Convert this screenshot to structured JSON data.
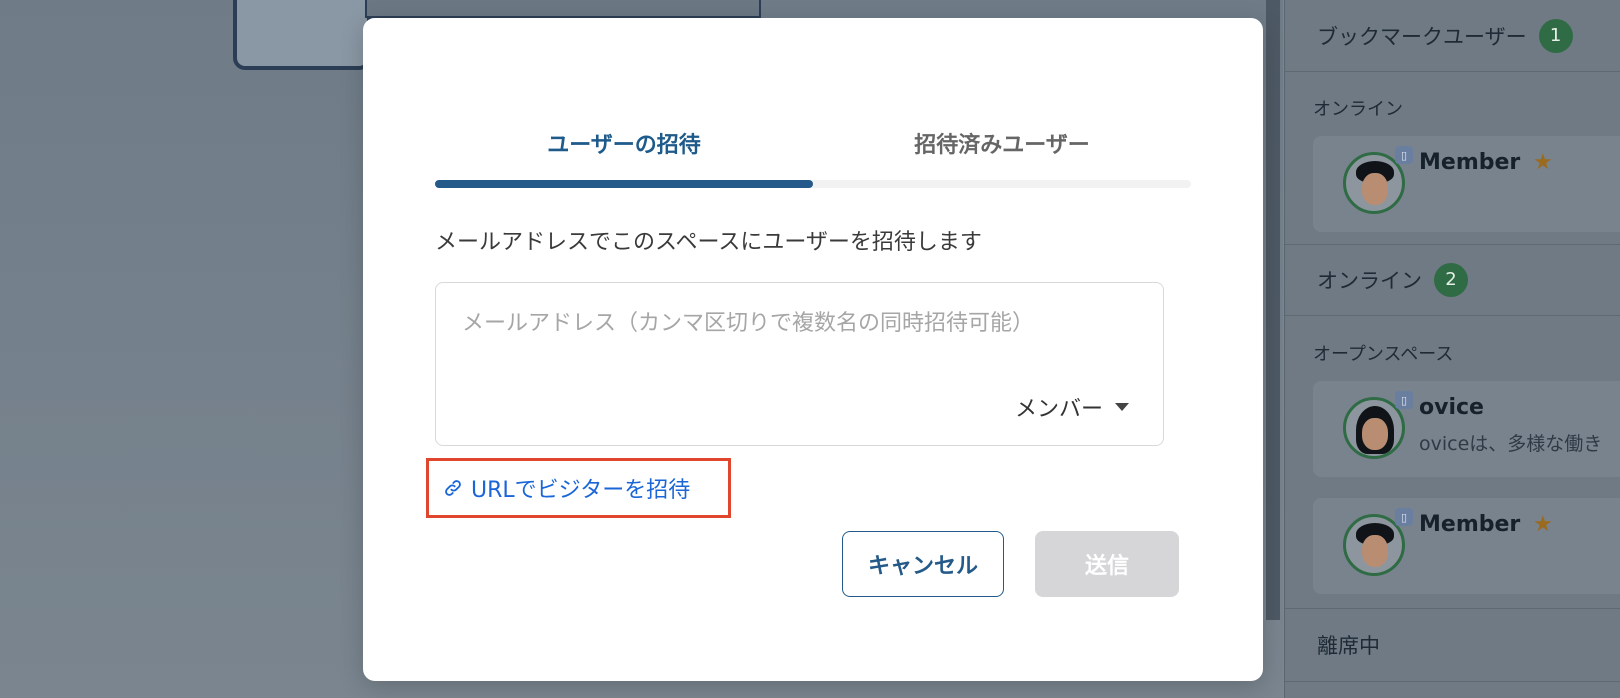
{
  "sidebar": {
    "bookmark_header": "ブックマークユーザー",
    "bookmark_count": "1",
    "online_label": "オンライン",
    "bookmark_member": {
      "name": "Member",
      "star": "★"
    },
    "online_header": "オンライン",
    "online_count": "2",
    "open_space_label": "オープンスペース",
    "users": [
      {
        "name": "ovice",
        "desc": "oviceは、多様な働き",
        "star": ""
      },
      {
        "name": "Member",
        "desc": "",
        "star": "★"
      }
    ],
    "away_header": "離席中",
    "device_icon": "▯"
  },
  "modal": {
    "tabs": [
      {
        "label": "ユーザーの招待",
        "active": true
      },
      {
        "label": "招待済みユーザー",
        "active": false
      }
    ],
    "description": "メールアドレスでこのスペースにユーザーを招待します",
    "email_placeholder": "メールアドレス（カンマ区切りで複数名の同時招待可能）",
    "email_value": "",
    "role_selected": "メンバー",
    "url_invite_label": "URLでビジターを招待",
    "cancel_label": "キャンセル",
    "send_label": "送信"
  },
  "colors": {
    "accent": "#235a89",
    "link": "#1a66d8",
    "highlight_border": "#e0452d",
    "badge": "#2f6b44",
    "disabled_button": "#d6d6d8"
  }
}
